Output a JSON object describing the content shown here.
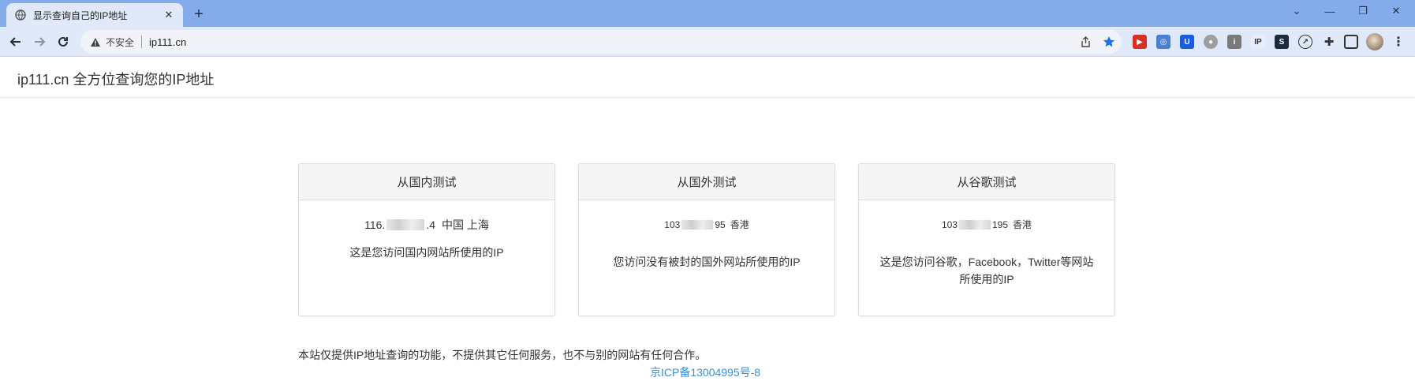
{
  "browser": {
    "tab_title": "显示查询自己的IP地址",
    "tab_close": "✕",
    "new_tab": "+",
    "security_label": "不安全",
    "url": "ip111.cn",
    "window_controls": {
      "dropdown": "⌄",
      "minimize": "—",
      "restore": "❐",
      "close": "✕"
    },
    "extension_icons": [
      "red-ext-icon",
      "blue-globe-ext-icon",
      "bitwarden-ext-icon",
      "globe-ext-icon",
      "info-ext-icon",
      "ip-ext-icon",
      "dark-ext-icon",
      "speed-ext-icon",
      "puzzle-icon",
      "sidebar-icon",
      "avatar",
      "menu-icon"
    ]
  },
  "site": {
    "brand": "ip111.cn 全方位查询您的IP地址"
  },
  "panels": [
    {
      "title": "从国内测试",
      "ip_prefix": "116.",
      "ip_suffix": ".4",
      "location": "中国 上海",
      "desc": "这是您访问国内网站所使用的IP"
    },
    {
      "title": "从国外测试",
      "ip_prefix": "103",
      "ip_suffix": "95",
      "location": "香港",
      "desc": "您访问没有被封的国外网站所使用的IP"
    },
    {
      "title": "从谷歌测试",
      "ip_prefix": "103",
      "ip_suffix": "195",
      "location": "香港",
      "desc_line1": "这是您访问谷歌，Facebook，Twitter等网站",
      "desc_line2": "所使用的IP"
    }
  ],
  "footer": {
    "notice": "本站仅提供IP地址查询的功能，不提供其它任何服务，也不与别的网站有任何合作。",
    "icp": "京ICP备13004995号-8"
  },
  "colors": {
    "tabstrip": "#85acea",
    "toolbar": "#dfe9fa",
    "link": "#3a8ed8"
  }
}
